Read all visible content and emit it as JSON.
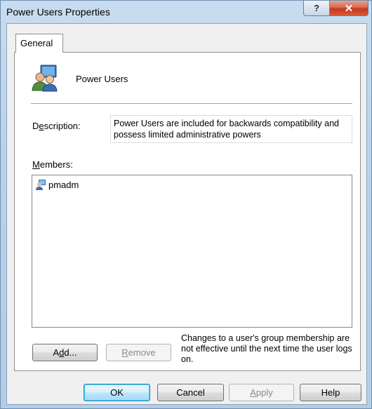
{
  "window": {
    "title": "Power Users Properties",
    "help_glyph": "?",
    "close_glyph": "✕"
  },
  "tabs": [
    {
      "label": "General",
      "selected": true
    }
  ],
  "group": {
    "name": "Power Users",
    "icon": "user-group-icon"
  },
  "description": {
    "label_pre": "D",
    "label_accel": "e",
    "label_post": "scription:",
    "value": "Power Users are included for backwards compatibility and possess limited administrative powers"
  },
  "members": {
    "label_accel": "M",
    "label_post": "embers:",
    "items": [
      {
        "name": "pmadm",
        "icon": "user-icon"
      }
    ]
  },
  "member_buttons": {
    "add_pre": "A",
    "add_accel": "d",
    "add_post": "d...",
    "remove_accel": "R",
    "remove_post": "emove"
  },
  "note": "Changes to a user's group membership are not effective until the next time the user logs on.",
  "dialog_buttons": {
    "ok": "OK",
    "cancel": "Cancel",
    "apply_accel": "A",
    "apply_post": "pply",
    "help": "Help"
  }
}
